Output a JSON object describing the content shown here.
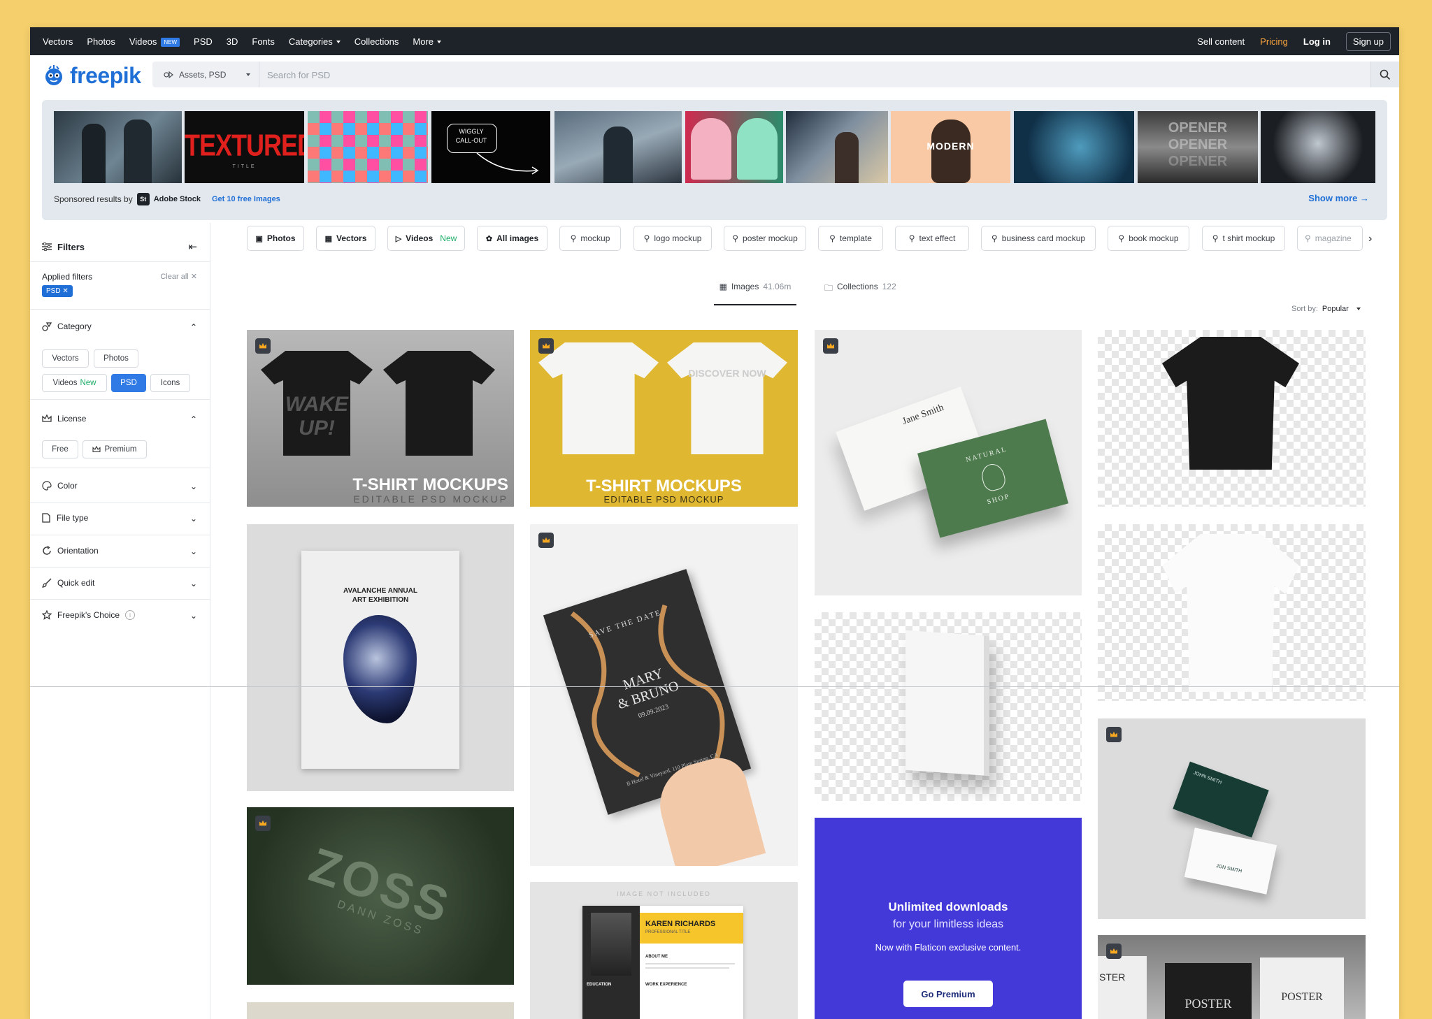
{
  "topnav": {
    "items": [
      "Vectors",
      "Photos",
      "Videos",
      "PSD",
      "3D",
      "Fonts",
      "Categories",
      "Collections",
      "More"
    ],
    "new_badge": "NEW",
    "right": {
      "sell": "Sell content",
      "pricing": "Pricing",
      "login": "Log in",
      "signup": "Sign up"
    }
  },
  "header": {
    "logo": "freepik",
    "asset_select": "Assets, PSD",
    "search_placeholder": "Search for PSD"
  },
  "sponsored": {
    "label": "Sponsored results by",
    "st_badge": "St",
    "brand": "Adobe Stock",
    "free_link": "Get 10 free Images",
    "show_more": "Show more",
    "thumb_text": {
      "textured": "TEXTURED",
      "textured_sub": "TITLE",
      "wiggly1": "WIGGLY",
      "wiggly2": "CALL-OUT",
      "modern": "MODERN",
      "opener": "OPENER"
    }
  },
  "sidebar": {
    "filters": "Filters",
    "applied": "Applied filters",
    "clear_all": "Clear all",
    "psd_chip": "PSD",
    "category": {
      "title": "Category",
      "chips": [
        "Vectors",
        "Photos",
        "Videos",
        "PSD",
        "Icons"
      ],
      "new": "New"
    },
    "license": {
      "title": "License",
      "chips": [
        "Free",
        "Premium"
      ]
    },
    "sections": [
      "Color",
      "File type",
      "Orientation",
      "Quick edit",
      "Freepik's Choice"
    ]
  },
  "tags": {
    "types": [
      "Photos",
      "Vectors",
      "Videos",
      "All images"
    ],
    "videos_new": "New",
    "searches": [
      "mockup",
      "logo mockup",
      "poster mockup",
      "template",
      "text effect",
      "business card mockup",
      "book mockup",
      "t shirt mockup",
      "magazine"
    ]
  },
  "tabs": {
    "images": {
      "label": "Images",
      "count": "41.06m"
    },
    "collections": {
      "label": "Collections",
      "count": "122"
    }
  },
  "sort": {
    "label": "Sort by:",
    "value": "Popular"
  },
  "cards": {
    "tshirt1_title": "T-SHIRT MOCKUPS",
    "tshirt1_sub": "EDITABLE PSD MOCKUP",
    "tshirt1_shirt": "WAKE UP!",
    "tshirt2_title": "T-SHIRT MOCKUPS",
    "tshirt2_sub": "EDITABLE PSD MOCKUP",
    "tshirt2_back": "DISCOVER NOW",
    "card_name": "Jane Smith",
    "card_brand1": "NATURAL",
    "card_brand2": "SHOP",
    "poster_title1": "AVALANCHE ANNUAL",
    "poster_title2": "ART EXHIBITION",
    "invite_top": "SAVE THE DATE",
    "invite_names1": "MARY",
    "invite_names2": "& BRUNO",
    "invite_date": "09.09.2023",
    "invite_addr": "B Hotel & Vineyard, 110 Plam Spring, CA",
    "zoss1": "ZOSS",
    "zoss2": "DANN ZOSS",
    "resume_note": "IMAGE NOT INCLUDED",
    "resume_name": "KAREN RICHARDS",
    "resume_title": "PROFESSIONAL TITLE",
    "resume_about": "ABOUT ME",
    "resume_edu": "EDUCATION",
    "resume_work": "WORK EXPERIENCE",
    "bc2_name": "JOHN SMITH",
    "bc2_name2": "JON SMITH",
    "poster_left": "STER",
    "poster_mid": "POSTER",
    "poster_right": "POSTER"
  },
  "premium": {
    "title": "Unlimited downloads",
    "subtitle": "for your limitless ideas",
    "text": "Now with Flaticon exclusive content.",
    "button": "Go Premium"
  },
  "colors": {
    "accent": "#1f6fd6",
    "premium": "#4338d8",
    "pricing": "#f8a33a",
    "page_bg": "#f4cf6b"
  }
}
